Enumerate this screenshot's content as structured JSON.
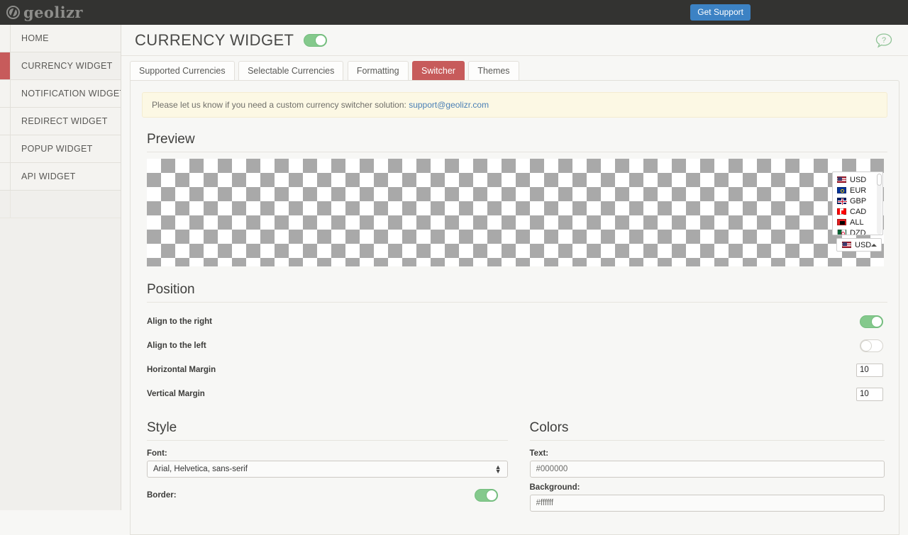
{
  "topbar": {
    "logo_text": "geolizr",
    "logo_icon": "globe-icon",
    "support_button": "Get Support"
  },
  "sidebar": {
    "items": [
      {
        "label": "HOME",
        "active": false
      },
      {
        "label": "CURRENCY WIDGET",
        "active": true
      },
      {
        "label": "NOTIFICATION WIDGET",
        "active": false
      },
      {
        "label": "REDIRECT WIDGET",
        "active": false
      },
      {
        "label": "POPUP WIDGET",
        "active": false
      },
      {
        "label": "API WIDGET",
        "active": false
      }
    ]
  },
  "header": {
    "title": "CURRENCY WIDGET",
    "widget_enabled": true,
    "help_icon": "question-bubble-icon"
  },
  "tabs": [
    {
      "label": "Supported Currencies",
      "active": false
    },
    {
      "label": "Selectable Currencies",
      "active": false
    },
    {
      "label": "Formatting",
      "active": false
    },
    {
      "label": "Switcher",
      "active": true
    },
    {
      "label": "Themes",
      "active": false
    }
  ],
  "notice": {
    "text": "Please let us know if you need a custom currency switcher solution: ",
    "link": "support@geolizr.com"
  },
  "preview": {
    "title": "Preview",
    "dropdown_open": true,
    "currencies": [
      {
        "code": "USD",
        "flag_colors": [
          "#b22234",
          "#ffffff",
          "#3c3b6e"
        ]
      },
      {
        "code": "EUR",
        "flag_colors": [
          "#003399",
          "#003399",
          "#ffcc00"
        ]
      },
      {
        "code": "GBP",
        "flag_colors": [
          "#c8102e",
          "#ffffff",
          "#012169"
        ]
      },
      {
        "code": "CAD",
        "flag_colors": [
          "#ff0000",
          "#ffffff",
          "#ff0000"
        ]
      },
      {
        "code": "ALL",
        "flag_colors": [
          "#e41e20",
          "#000000",
          "#e41e20"
        ]
      },
      {
        "code": "DZD",
        "flag_colors": [
          "#006233",
          "#ffffff",
          "#d21034"
        ]
      }
    ],
    "selected_currency": "USD"
  },
  "position": {
    "title": "Position",
    "rows": [
      {
        "label": "Align to the right",
        "type": "toggle",
        "value": true
      },
      {
        "label": "Align to the left",
        "type": "toggle",
        "value": false
      },
      {
        "label": "Horizontal Margin",
        "type": "number",
        "value": "10"
      },
      {
        "label": "Vertical Margin",
        "type": "number",
        "value": "10"
      }
    ]
  },
  "style": {
    "title": "Style",
    "font_label": "Font:",
    "font_value": "Arial, Helvetica, sans-serif",
    "border_label": "Border:",
    "border_enabled": true
  },
  "colors": {
    "title": "Colors",
    "text_label": "Text:",
    "text_value": "#000000",
    "background_label": "Background:",
    "background_value": "#ffffff"
  },
  "theme": {
    "accent_red": "#c75b5b",
    "toggle_green": "#84c98c",
    "link_blue": "#4a7fb5",
    "button_blue": "#3c82c4",
    "topbar_dark": "#333331"
  }
}
